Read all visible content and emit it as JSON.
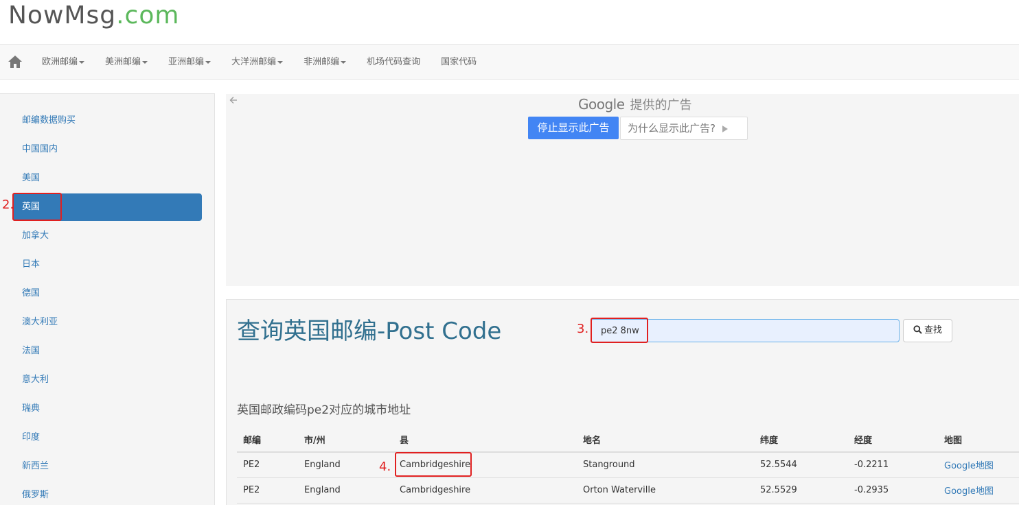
{
  "logo": {
    "brand": "NowMsg",
    "tld": ".com"
  },
  "nav": {
    "home_icon": "home-icon",
    "items": [
      {
        "label": "欧洲邮编",
        "dropdown": true
      },
      {
        "label": "美洲邮编",
        "dropdown": true
      },
      {
        "label": "亚洲邮编",
        "dropdown": true
      },
      {
        "label": "大洋洲邮编",
        "dropdown": true
      },
      {
        "label": "非洲邮编",
        "dropdown": true
      },
      {
        "label": "机场代码查询",
        "dropdown": false
      },
      {
        "label": "国家代码",
        "dropdown": false
      }
    ]
  },
  "sidebar": {
    "items": [
      "邮编数据购买",
      "中国国内",
      "美国",
      "英国",
      "加拿大",
      "日本",
      "德国",
      "澳大利亚",
      "法国",
      "意大利",
      "瑞典",
      "印度",
      "新西兰",
      "俄罗斯"
    ],
    "active": "英国"
  },
  "ad": {
    "back_icon": "arrow-left-icon",
    "google": "Google",
    "provided": "提供的广告",
    "stop_label": "停止显示此广告",
    "why_label": "为什么显示此广告?"
  },
  "main": {
    "title": "查询英国邮编-Post Code",
    "search_value": "pe2 8nw",
    "search_button": "查找",
    "subtitle": "英国邮政编码pe2对应的城市地址",
    "table": {
      "headers": [
        "邮编",
        "市/州",
        "县",
        "地名",
        "纬度",
        "经度",
        "地图"
      ],
      "rows": [
        [
          "PE2",
          "England",
          "Cambridgeshire",
          "Stanground",
          "52.5544",
          "-0.2211",
          "Google地图"
        ],
        [
          "PE2",
          "England",
          "Cambridgeshire",
          "Orton Waterville",
          "52.5529",
          "-0.2935",
          "Google地图"
        ]
      ]
    }
  },
  "annotations": {
    "a2": "2.",
    "a3": "3.",
    "a4": "4."
  },
  "colors": {
    "link": "#337ab7",
    "active": "#337ab7",
    "title": "#31708f",
    "annotation": "#e02020",
    "tld": "#5cb85c"
  }
}
